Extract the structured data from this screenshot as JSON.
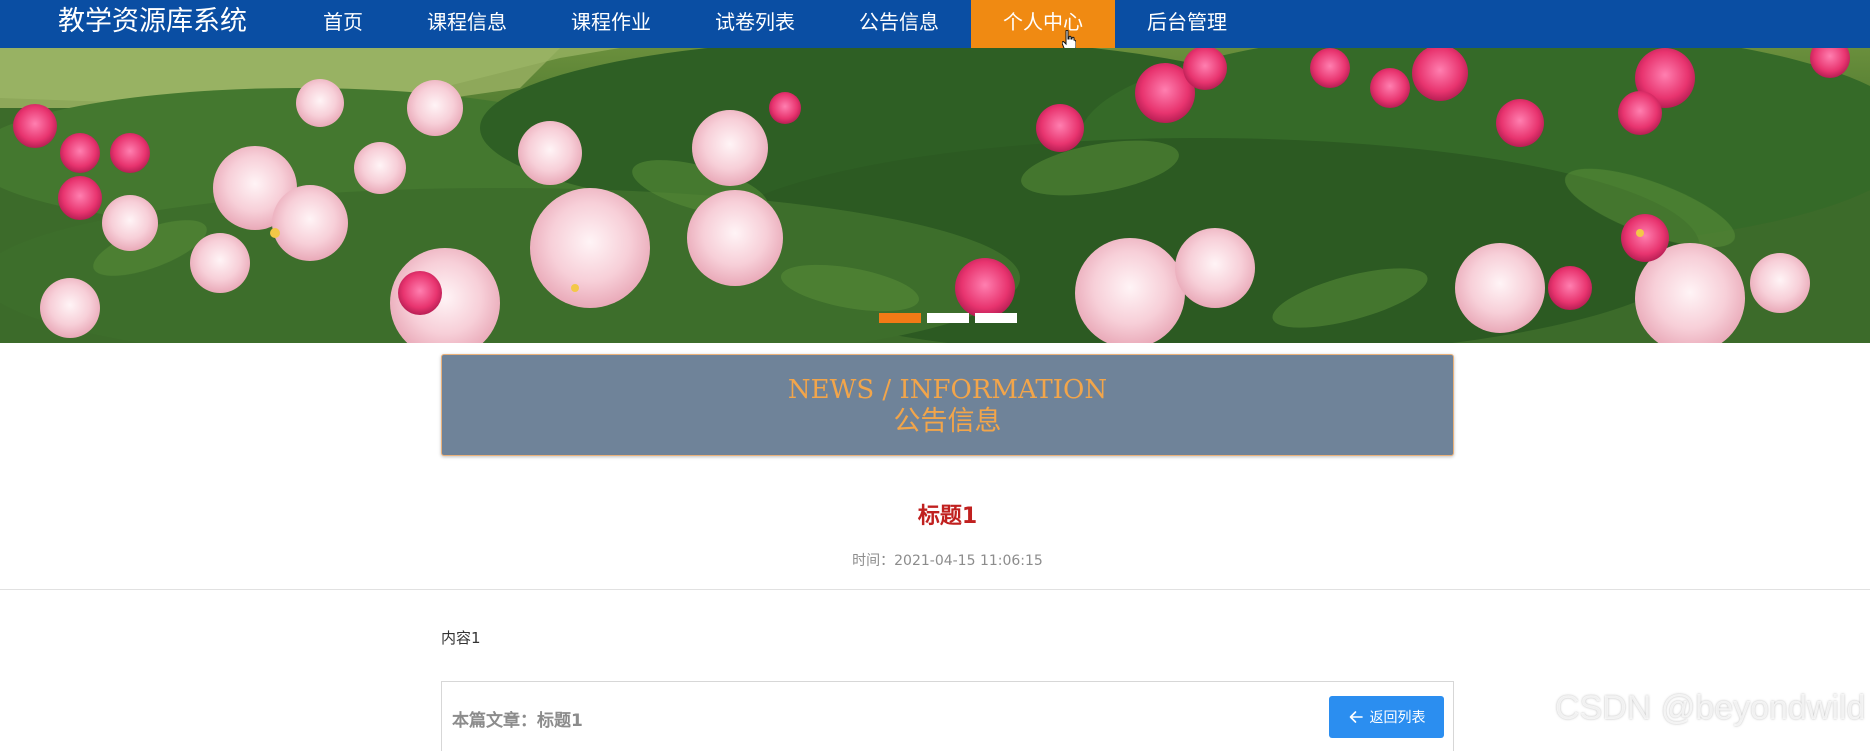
{
  "app": {
    "title": "教学资源库系统"
  },
  "nav": {
    "items": [
      {
        "label": "首页",
        "active": false
      },
      {
        "label": "课程信息",
        "active": false
      },
      {
        "label": "课程作业",
        "active": false
      },
      {
        "label": "试卷列表",
        "active": false
      },
      {
        "label": "公告信息",
        "active": false
      },
      {
        "label": "个人中心",
        "active": true
      },
      {
        "label": "后台管理",
        "active": false
      }
    ]
  },
  "banner": {
    "slide_count": 3,
    "active_slide": 1
  },
  "section": {
    "title_en": "NEWS / INFORMATION",
    "title_cn": "公告信息"
  },
  "article": {
    "title": "标题1",
    "time": "时间：2021-04-15 11:06:15",
    "content": "内容1"
  },
  "footer": {
    "current_label": "本篇文章：标题1",
    "back_label": "返回列表"
  },
  "watermark": "CSDN @beyondwild",
  "colors": {
    "nav_bg": "#0a4ea3",
    "nav_active": "#f08a12",
    "section_bg": "#6f8399",
    "section_text": "#f2a54a",
    "title_red": "#c0201f",
    "button_blue": "#2b8ef0"
  }
}
